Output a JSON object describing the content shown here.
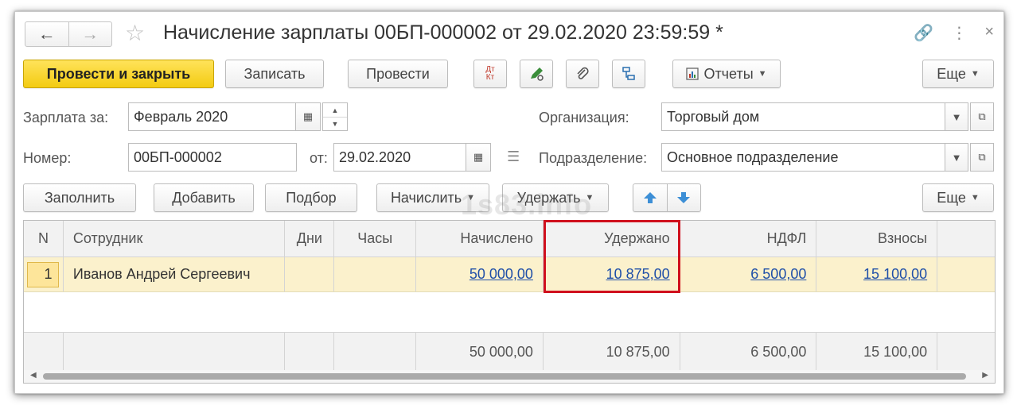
{
  "window": {
    "title": "Начисление зарплаты 00БП-000002 от 29.02.2020 23:59:59 *",
    "nav_back": "←",
    "nav_forward": "→",
    "star": "☆",
    "link_icon": "🔗",
    "menu_icon": "⋮",
    "close_icon": "×"
  },
  "toolbar": {
    "post_close_label": "Провести и закрыть",
    "save_label": "Записать",
    "post_label": "Провести",
    "dtkt_icon_label": "Дт Кт",
    "reports_label": "Отчеты",
    "more_label": "Еще"
  },
  "form": {
    "salary_for_label": "Зарплата за:",
    "salary_for_value": "Февраль 2020",
    "number_label": "Номер:",
    "number_value": "00БП-000002",
    "date_label": "от:",
    "date_value": "29.02.2020",
    "org_label": "Организация:",
    "org_value": "Торговый дом",
    "dept_label": "Подразделение:",
    "dept_value": "Основное подразделение"
  },
  "table_toolbar": {
    "fill_label": "Заполнить",
    "add_label": "Добавить",
    "select_label": "Подбор",
    "accrue_label": "Начислить",
    "withhold_label": "Удержать",
    "more_label": "Еще"
  },
  "watermark": "1s83.info",
  "table": {
    "headers": {
      "n": "N",
      "employee": "Сотрудник",
      "days": "Дни",
      "hours": "Часы",
      "accrued": "Начислено",
      "withheld": "Удержано",
      "ndfl": "НДФЛ",
      "contributions": "Взносы"
    },
    "rows": [
      {
        "n": "1",
        "employee": "Иванов Андрей Сергеевич",
        "days": "",
        "hours": "",
        "accrued": "50 000,00",
        "withheld": "10 875,00",
        "ndfl": "6 500,00",
        "contributions": "15 100,00"
      }
    ],
    "totals": {
      "accrued": "50 000,00",
      "withheld": "10 875,00",
      "ndfl": "6 500,00",
      "contributions": "15 100,00"
    }
  },
  "colors": {
    "primary_button": "#f3cb12",
    "selected_row": "#fbf1cc",
    "highlight_border": "#d0101d",
    "link": "#1f4fa8"
  }
}
